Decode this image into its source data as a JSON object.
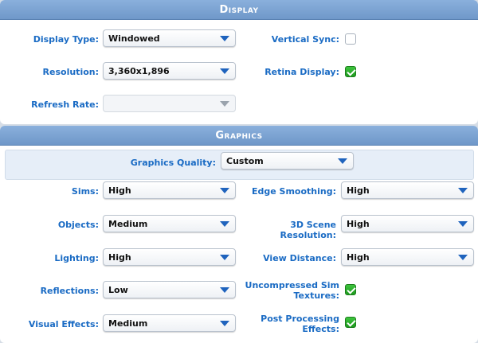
{
  "display": {
    "header": "Display",
    "display_type": {
      "label": "Display Type:",
      "value": "Windowed"
    },
    "resolution": {
      "label": "Resolution:",
      "value": "3,360x1,896"
    },
    "refresh_rate": {
      "label": "Refresh Rate:",
      "value": ""
    },
    "vertical_sync": {
      "label": "Vertical Sync:",
      "checked": false
    },
    "retina_display": {
      "label": "Retina Display:",
      "checked": true
    }
  },
  "graphics": {
    "header": "Graphics",
    "quality": {
      "label": "Graphics Quality:",
      "value": "Custom"
    },
    "sims": {
      "label": "Sims:",
      "value": "High"
    },
    "objects": {
      "label": "Objects:",
      "value": "Medium"
    },
    "lighting": {
      "label": "Lighting:",
      "value": "High"
    },
    "reflections": {
      "label": "Reflections:",
      "value": "Low"
    },
    "visual_effects": {
      "label": "Visual Effects:",
      "value": "Medium"
    },
    "edge_smoothing": {
      "label": "Edge Smoothing:",
      "value": "High"
    },
    "scene_resolution": {
      "label": "3D Scene Resolution:",
      "value": "High"
    },
    "view_distance": {
      "label": "View Distance:",
      "value": "High"
    },
    "uncompressed_textures": {
      "label_line1": "Uncompressed Sim",
      "label_line2": "Textures:",
      "checked": true
    },
    "post_processing": {
      "label_line1": "Post Processing",
      "label_line2": "Effects:",
      "checked": true
    }
  },
  "colors": {
    "label_blue": "#1a6bc4",
    "header_blue": "#7aa2d4",
    "check_green": "#2fb02f"
  }
}
